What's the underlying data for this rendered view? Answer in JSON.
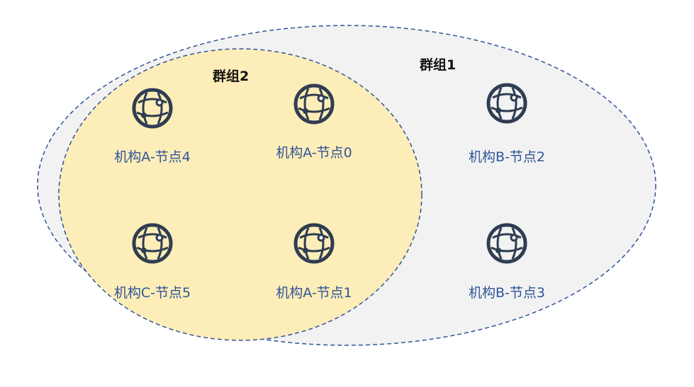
{
  "colors": {
    "group1_fill": "#f2f2f2",
    "group2_fill": "#fdedb8",
    "outline": "#2f5597",
    "icon": "#2f3d52",
    "node_text": "#2f5597",
    "group_text": "#111111"
  },
  "groups": [
    {
      "label": "群组1"
    },
    {
      "label": "群组2"
    }
  ],
  "nodes": [
    {
      "label": "机构A-节点4",
      "icon": "network-globe-icon",
      "group": "群组2"
    },
    {
      "label": "机构A-节点0",
      "icon": "network-globe-icon",
      "group": "群组2"
    },
    {
      "label": "机构C-节点5",
      "icon": "network-globe-icon",
      "group": "群组2"
    },
    {
      "label": "机构A-节点1",
      "icon": "network-globe-icon",
      "group": "群组2"
    },
    {
      "label": "机构B-节点2",
      "icon": "network-globe-icon",
      "group": "群组1"
    },
    {
      "label": "机构B-节点3",
      "icon": "network-globe-icon",
      "group": "群组1"
    }
  ]
}
